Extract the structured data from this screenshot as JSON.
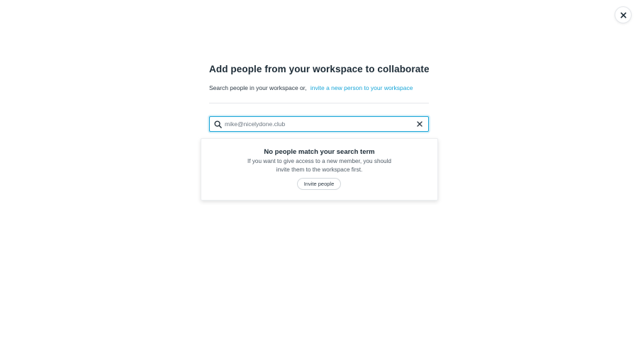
{
  "dialog": {
    "title": "Add people from your workspace to collaborate",
    "subtitle_prefix": "Search people in your workspace or,",
    "invite_link_label": "invite a new person to your workspace"
  },
  "search": {
    "value": "mike@nicelydone.club",
    "search_icon": "search-icon",
    "clear_icon": "close-icon"
  },
  "results": {
    "empty_title": "No people match your search term",
    "empty_description": "If you want to give access to a new member, you should invite them to the workspace first.",
    "invite_button_label": "Invite people"
  },
  "close_icon": "close-icon",
  "colors": {
    "accent": "#1aa6d8",
    "text_dark": "#1c2b36",
    "text_muted": "#4f5b66"
  }
}
